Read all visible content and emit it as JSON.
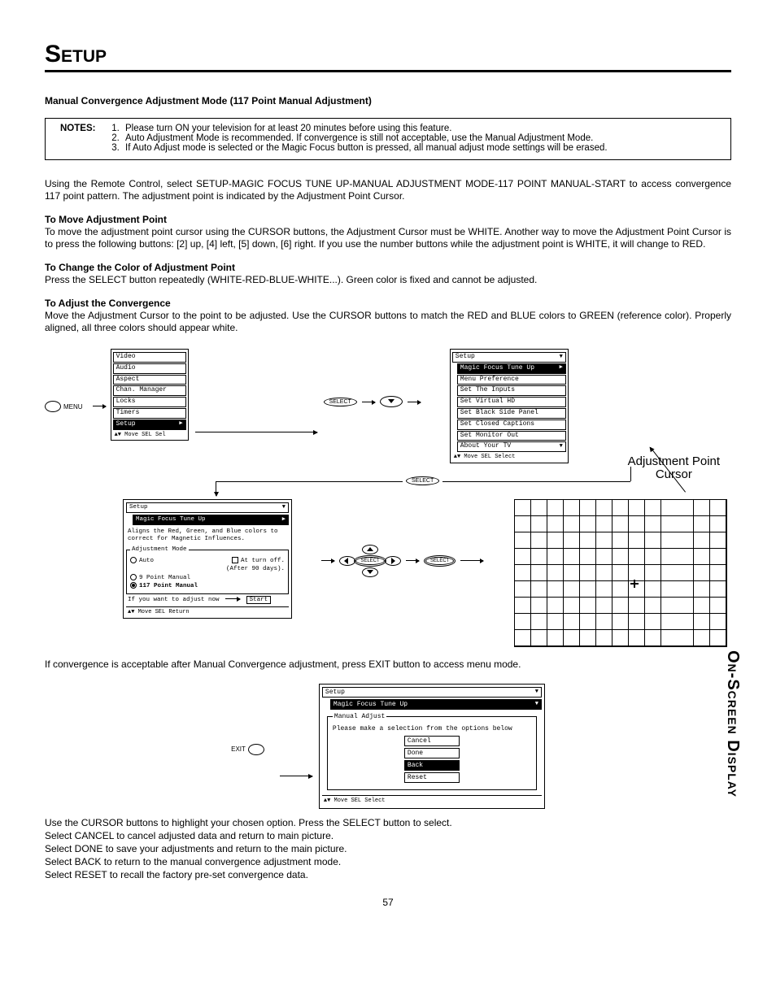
{
  "page": {
    "title": "Setup",
    "side_tab": "On-Screen Display",
    "number": "57"
  },
  "heading1": "Manual Convergence Adjustment Mode (117 Point Manual Adjustment)",
  "notes": {
    "label": "NOTES:",
    "n1": "Please turn ON your television for at least 20 minutes before using this feature.",
    "n2": "Auto Adjustment Mode is recommended.  If convergence is still not acceptable, use the Manual Adjustment Mode.",
    "n3": "If Auto Adjust mode is selected or the Magic Focus button is pressed, all manual adjust mode settings will be erased."
  },
  "intro": "Using the Remote Control, select SETUP-MAGIC FOCUS TUNE UP-MANUAL ADJUSTMENT MODE-117 POINT MANUAL-START to access convergence 117 point pattern.  The adjustment point is indicated by the Adjustment Point Cursor.",
  "move": {
    "title": "To Move Adjustment Point",
    "body": "To move the adjustment point cursor using the CURSOR buttons, the Adjustment Cursor must be WHITE.  Another way to move the Adjustment Point Cursor is to press the following buttons:  [2] up, [4] left, [5] down, [6] right.  If you use the number buttons while the adjustment point is WHITE, it will change to RED."
  },
  "color": {
    "title": "To Change the Color of Adjustment Point",
    "body": "Press the SELECT button repeatedly (WHITE-RED-BLUE-WHITE...).  Green color is fixed and cannot be adjusted."
  },
  "adjust": {
    "title": "To Adjust the Convergence",
    "body": "Move the Adjustment Cursor to the point to be adjusted.  Use the CURSOR buttons to match the RED and BLUE colors to GREEN (reference color).  Properly aligned, all three colors should appear white."
  },
  "menu_label": "MENU",
  "select_label": "SELECT",
  "exit_label": "EXIT",
  "adj_cursor_label1": "Adjustment Point",
  "adj_cursor_label2": "Cursor",
  "osd_main": {
    "i0": "Video",
    "i1": "Audio",
    "i2": "Aspect",
    "i3": "Chan. Manager",
    "i4": "Locks",
    "i5": "Timers",
    "i6": "Setup",
    "footer": "▲▼ Move  SEL  Sel"
  },
  "osd_setup": {
    "title": "Setup",
    "i0": "Magic Focus Tune Up",
    "i1": "Menu Preference",
    "i2": "Set The Inputs",
    "i3": "Set Virtual HD",
    "i4": "Set Black Side Panel",
    "i5": "Set Closed Captions",
    "i6": "Set Monitor Out",
    "i7": "About Your TV",
    "footer": "▲▼ Move  SEL  Select"
  },
  "osd_detail": {
    "title": "Setup",
    "sub": "Magic Focus Tune Up",
    "desc": "Aligns the Red, Green, and Blue colors to correct for Magnetic Influences.",
    "legend": "Adjustment Mode",
    "auto": "Auto",
    "turn": "At turn off.",
    "turn2": "(After 90 days).",
    "p9": "9 Point Manual",
    "p117": "117 Point Manual",
    "adjust_now": "If you want to adjust now",
    "start": "Start",
    "footer": "▲▼ Move  SEL  Return"
  },
  "osd_exit": {
    "title": "Setup",
    "sub": "Magic Focus Tune Up",
    "legend": "Manual Adjust",
    "prompt": "Please make a selection from the options below",
    "b0": "Cancel",
    "b1": "Done",
    "b2": "Back",
    "b3": "Reset",
    "footer": "▲▼ Move  SEL  Select"
  },
  "after_adjust": "If convergence is acceptable after Manual Convergence adjustment, press EXIT button to access menu mode.",
  "closing": {
    "l0": "Use the CURSOR buttons to highlight your chosen option.  Press the SELECT button to select.",
    "l1": "Select CANCEL to cancel adjusted data and return to main picture.",
    "l2": "Select DONE to save your adjustments and return to the main picture.",
    "l3": "Select BACK to return to the manual convergence adjustment mode.",
    "l4": "Select RESET to recall the factory pre-set convergence data."
  }
}
